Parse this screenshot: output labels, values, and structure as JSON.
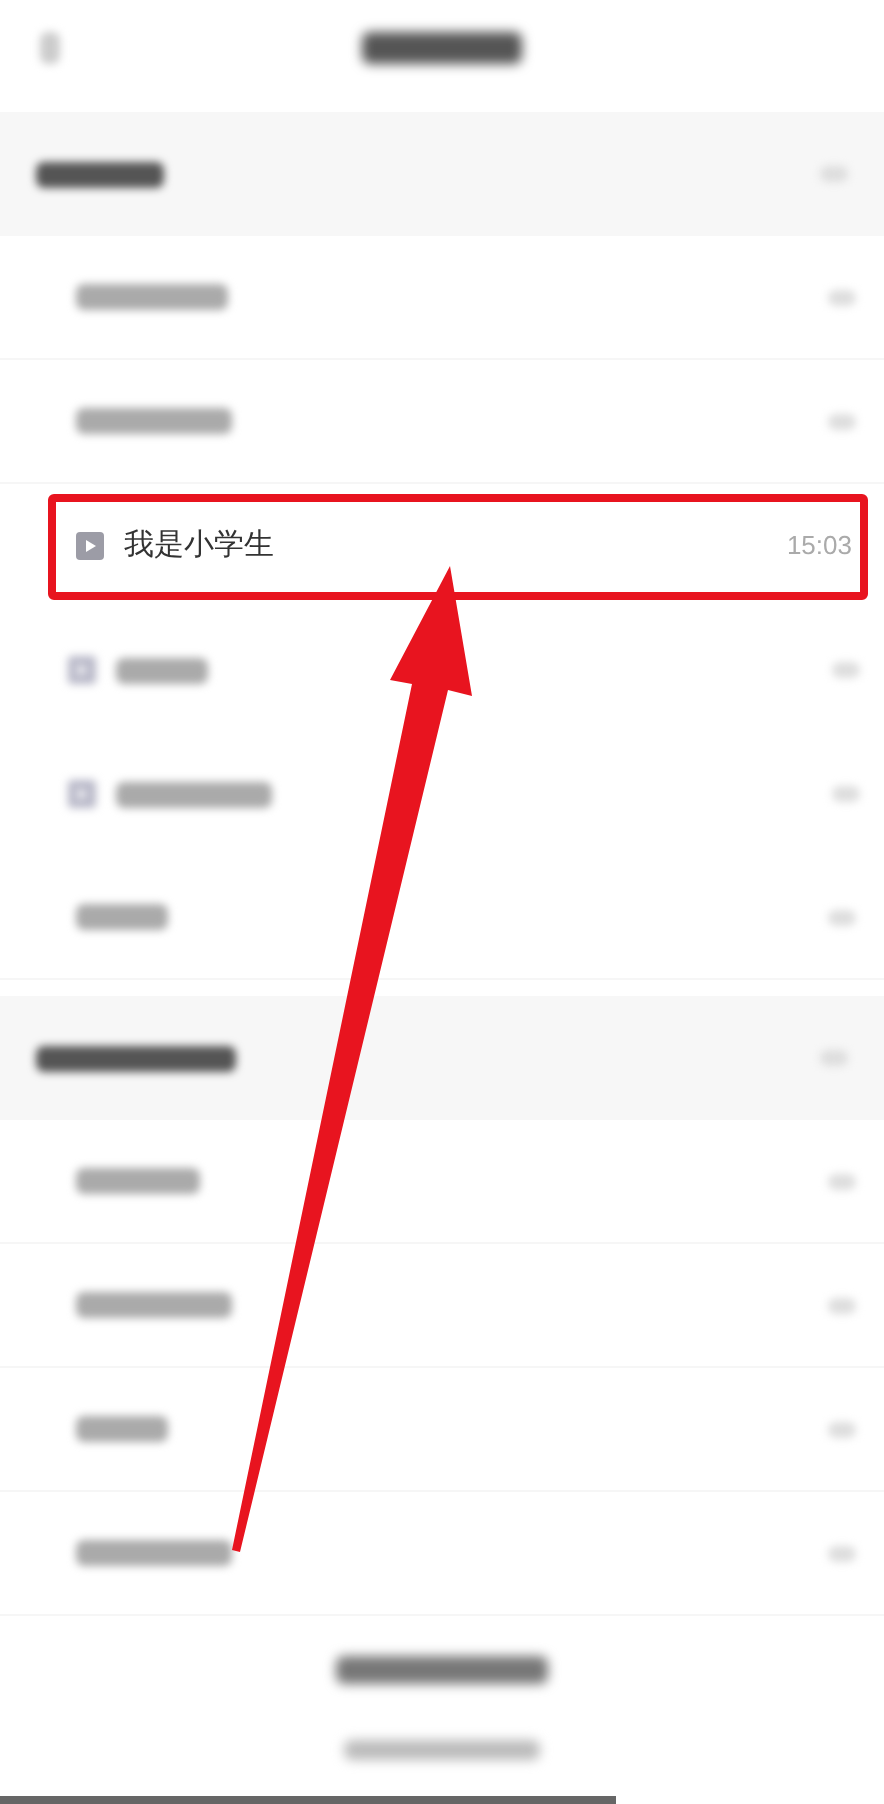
{
  "sections": [
    {
      "items": [
        {
          "kind": "chapter"
        },
        {
          "kind": "chapter"
        },
        {
          "kind": "lesson",
          "title": "我是小学生",
          "time": "15:03",
          "highlighted": true
        },
        {
          "kind": "lesson"
        },
        {
          "kind": "lesson"
        },
        {
          "kind": "chapter"
        }
      ]
    },
    {
      "items": [
        {
          "kind": "chapter"
        },
        {
          "kind": "chapter"
        },
        {
          "kind": "chapter"
        },
        {
          "kind": "chapter"
        }
      ]
    }
  ]
}
